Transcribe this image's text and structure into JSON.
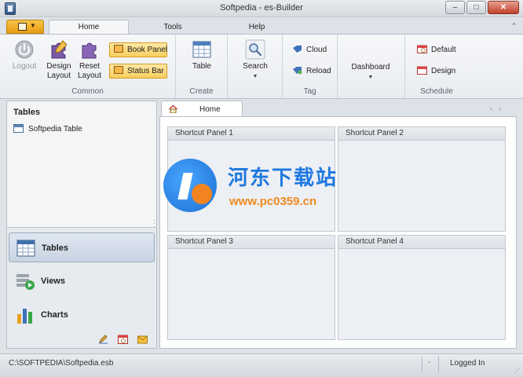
{
  "window": {
    "title": "Softpedia - es-Builder",
    "minimize_label": "–",
    "maximize_label": "□",
    "close_label": "✕"
  },
  "ribbon_tabs": [
    {
      "label": "Home",
      "active": true
    },
    {
      "label": "Tools",
      "active": false
    },
    {
      "label": "Help",
      "active": false
    }
  ],
  "ribbon": {
    "common": {
      "label": "Common",
      "logout": "Logout",
      "design_layout": "Design Layout",
      "reset_layout": "Reset Layout",
      "book_panel": "Book Panel",
      "status_bar": "Status Bar"
    },
    "create": {
      "label": "Create",
      "table": "Table"
    },
    "search": {
      "label": "Search"
    },
    "tag": {
      "label": "Tag",
      "cloud": "Cloud",
      "reload": "Reload"
    },
    "dashboard": {
      "label": "Dashboard"
    },
    "schedule": {
      "label": "Schedule",
      "default": "Default",
      "design": "Design"
    }
  },
  "left_panel": {
    "title": "Tables",
    "tree_items": [
      "Softpedia Table"
    ],
    "nav_items": [
      {
        "label": "Tables",
        "icon": "table-icon",
        "active": true
      },
      {
        "label": "Views",
        "icon": "views-icon",
        "active": false
      },
      {
        "label": "Charts",
        "icon": "chart-icon",
        "active": false
      }
    ]
  },
  "document": {
    "tab_label": "Home",
    "panels": [
      "Shortcut Panel 1",
      "Shortcut Panel 2",
      "Shortcut Panel 3",
      "Shortcut Panel 4"
    ]
  },
  "watermark": {
    "chinese": "河东下载站",
    "url": "www.pc0359.cn"
  },
  "statusbar": {
    "path": "C:\\SOFTPEDIA\\Softpedia.esb",
    "separator": "-",
    "login_status": "Logged In"
  },
  "colors": {
    "accent_orange": "#e89b10",
    "toggle_yellow": "#f8cf5d",
    "watermark_blue": "#1f78e0",
    "watermark_orange": "#f08a1e"
  }
}
